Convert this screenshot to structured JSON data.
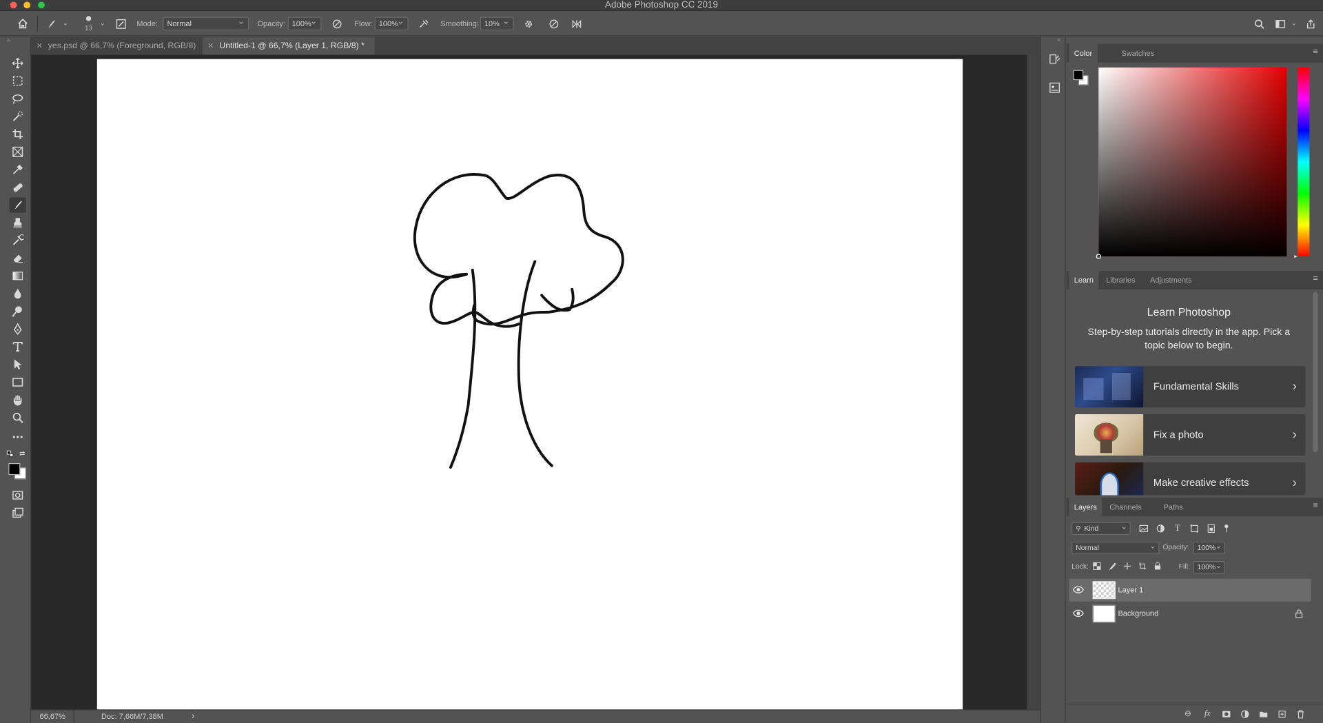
{
  "app": {
    "title": "Adobe Photoshop CC 2019"
  },
  "options_bar": {
    "brush_size": "13",
    "mode_label": "Mode:",
    "mode_value": "Normal",
    "opacity_label": "Opacity:",
    "opacity_value": "100%",
    "flow_label": "Flow:",
    "flow_value": "100%",
    "smoothing_label": "Smoothing:",
    "smoothing_value": "10%"
  },
  "document_tabs": [
    {
      "label": "yes.psd @ 66,7% (Foreground, RGB/8)",
      "active": false
    },
    {
      "label": "Untitled-1 @ 66,7% (Layer 1, RGB/8) *",
      "active": true
    }
  ],
  "tools": [
    "move-tool",
    "marquee-tool",
    "lasso-tool",
    "quick-select-tool",
    "crop-tool",
    "frame-tool",
    "eyedropper-tool",
    "healing-tool",
    "brush-tool",
    "stamp-tool",
    "history-brush-tool",
    "eraser-tool",
    "gradient-tool",
    "blur-tool",
    "dodge-tool",
    "pen-tool",
    "type-tool",
    "path-select-tool",
    "rectangle-tool",
    "hand-tool",
    "zoom-tool",
    "more-tools"
  ],
  "status_bar": {
    "zoom": "66,67%",
    "doc_info": "Doc: 7,66M/7,38M"
  },
  "color_panel": {
    "tabs": [
      "Color",
      "Swatches"
    ],
    "hue_color": "#e30000",
    "foreground": "#000000",
    "background": "#ffffff"
  },
  "learn_panel": {
    "tabs": [
      "Learn",
      "Libraries",
      "Adjustments"
    ],
    "title": "Learn Photoshop",
    "subtitle": "Step-by-step tutorials directly in the app. Pick a topic below to begin.",
    "cards": [
      {
        "label": "Fundamental Skills"
      },
      {
        "label": "Fix a photo"
      },
      {
        "label": "Make creative effects"
      }
    ]
  },
  "layers_panel": {
    "tabs": [
      "Layers",
      "Channels",
      "Paths"
    ],
    "filter_kind": "Kind",
    "blend_mode": "Normal",
    "opacity_label": "Opacity:",
    "opacity_value": "100%",
    "lock_label": "Lock:",
    "fill_label": "Fill:",
    "fill_value": "100%",
    "layers": [
      {
        "name": "Layer 1",
        "selected": true,
        "locked": false
      },
      {
        "name": "Background",
        "selected": false,
        "locked": true
      }
    ]
  }
}
